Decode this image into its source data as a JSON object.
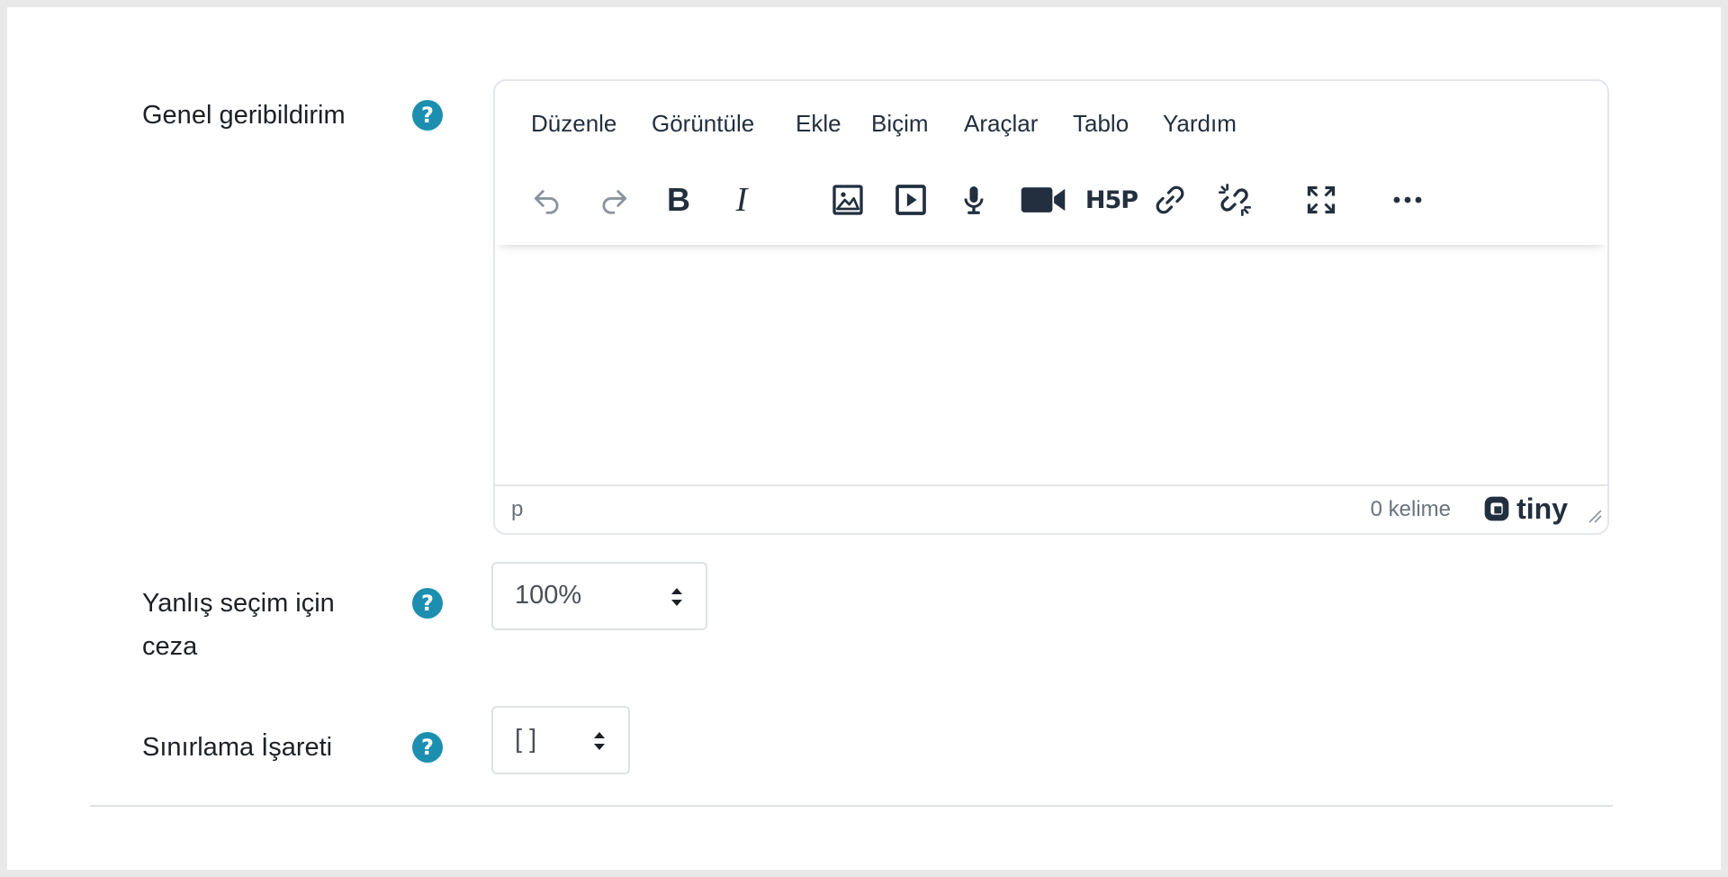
{
  "fields": {
    "general_feedback": {
      "label": "Genel geribildirim",
      "help": "?"
    },
    "penalty": {
      "label_line1": "Yanlış seçim için",
      "label_line2": "ceza",
      "help": "?",
      "selected": "100%"
    },
    "delimiter": {
      "label": "Sınırlama İşareti",
      "help": "?",
      "selected": "[ ]"
    }
  },
  "editor": {
    "menu": [
      "Düzenle",
      "Görüntüle",
      "Ekle",
      "Biçim",
      "Araçlar",
      "Tablo",
      "Yardım"
    ],
    "toolbar": {
      "undo": "undo-icon",
      "redo": "redo-icon",
      "bold": "B",
      "italic": "I",
      "image": "image-icon",
      "media": "media-icon",
      "record_audio": "microphone-icon",
      "record_video": "video-camera-icon",
      "h5p": "H5P",
      "link": "link-icon",
      "unlink": "unlink-icon",
      "fullscreen": "fullscreen-icon",
      "more": "more-icon"
    },
    "status": {
      "path": "p",
      "word_count": "0 kelime",
      "brand": "tiny"
    }
  },
  "colors": {
    "help_badge": "#1c8fb0",
    "text": "#1d2125",
    "border": "#dee2e6",
    "toolbar_icon": "#222f3e",
    "disabled_icon": "#8a949e"
  }
}
